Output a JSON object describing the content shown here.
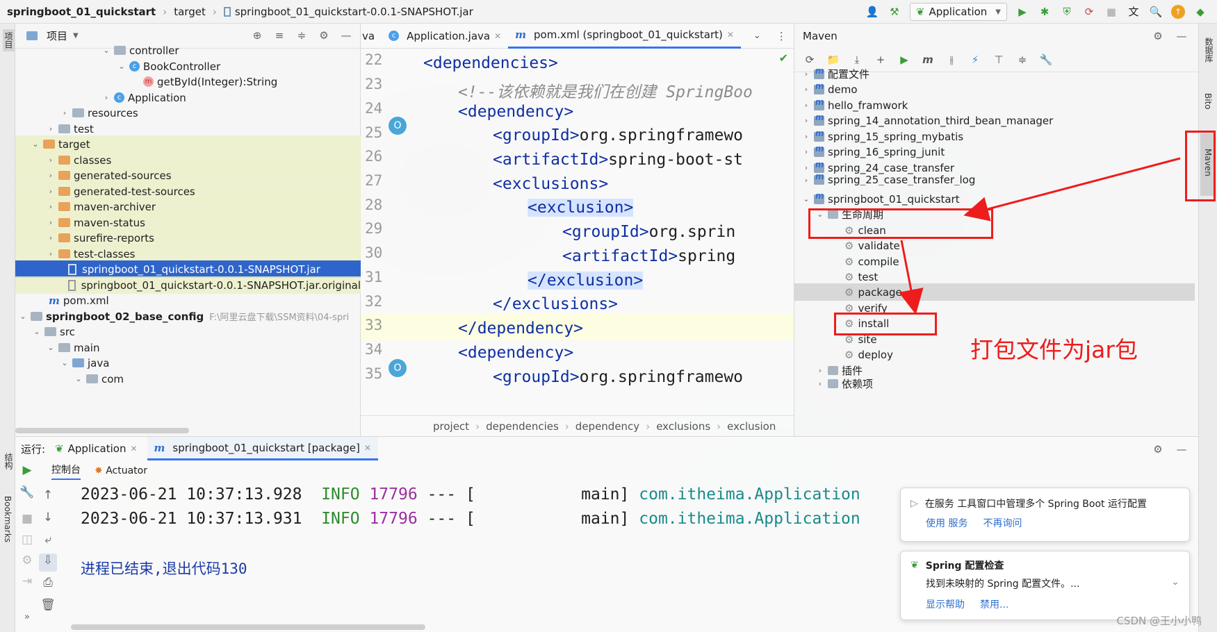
{
  "breadcrumb": {
    "project": "springboot_01_quickstart",
    "folder": "target",
    "file": "springboot_01_quickstart-0.0.1-SNAPSHOT.jar"
  },
  "toolbar": {
    "run_config": "Application"
  },
  "left_strip": {
    "project_tab": "项目",
    "structure_tab": "结构",
    "bookmarks_tab": "Bookmarks"
  },
  "project_panel": {
    "title": "项目",
    "rows": [
      "controller",
      "BookController",
      "getById(Integer):String",
      "Application",
      "resources",
      "test",
      "target",
      "classes",
      "generated-sources",
      "generated-test-sources",
      "maven-archiver",
      "maven-status",
      "surefire-reports",
      "test-classes",
      "springboot_01_quickstart-0.0.1-SNAPSHOT.jar",
      "springboot_01_quickstart-0.0.1-SNAPSHOT.jar.original",
      "pom.xml",
      "springboot_02_base_config",
      "src",
      "main",
      "java",
      "com"
    ],
    "path_hint": "F:\\阿里云盘下载\\SSM资料\\04-spri"
  },
  "editor": {
    "tabs": [
      "va",
      "Application.java",
      "pom.xml (springboot_01_quickstart)"
    ],
    "line_numbers": [
      "22",
      "23",
      "24",
      "25",
      "26",
      "27",
      "28",
      "29",
      "30",
      "31",
      "32",
      "33",
      "34",
      "35"
    ],
    "lines": [
      {
        "open": "<",
        "name": "dependencies",
        "close": ">"
      },
      {
        "comment": "<!--该依赖就是我们在创建 SpringBoo"
      },
      {
        "open": "<",
        "name": "dependency",
        "close": ">"
      },
      {
        "open": "<",
        "name": "groupId",
        "close": ">",
        "text": "org.springframewo"
      },
      {
        "open": "<",
        "name": "artifactId",
        "close": ">",
        "text": "spring-boot-st"
      },
      {
        "open": "<",
        "name": "exclusions",
        "close": ">"
      },
      {
        "open": "<",
        "name": "exclusion",
        "close": ">"
      },
      {
        "open": "<",
        "name": "groupId",
        "close": ">",
        "text": "org.sprin"
      },
      {
        "open": "<",
        "name": "artifactId",
        "close": ">",
        "text": "spring"
      },
      {
        "open": "</",
        "name": "exclusion",
        "close": ">"
      },
      {
        "open": "</",
        "name": "exclusions",
        "close": ">"
      },
      {
        "open": "</",
        "name": "dependency",
        "close": ">"
      },
      {
        "open": "<",
        "name": "dependency",
        "close": ">"
      },
      {
        "open": "<",
        "name": "groupId",
        "close": ">",
        "text": "org.springframewo"
      }
    ],
    "breadcrumb": [
      "project",
      "dependencies",
      "dependency",
      "exclusions",
      "exclusion"
    ]
  },
  "maven": {
    "title": "Maven",
    "projects": [
      "配置文件",
      "demo",
      "hello_framwork",
      "spring_14_annotation_third_bean_manager",
      "spring_15_spring_mybatis",
      "spring_16_spring_junit",
      "spring_24_case_transfer",
      "spring_25_case_transfer_log",
      "springboot_01_quickstart"
    ],
    "lifecycle_label": "生命周期",
    "phases": [
      "clean",
      "validate",
      "compile",
      "test",
      "package",
      "verify",
      "install",
      "site",
      "deploy"
    ],
    "plugins_label": "插件",
    "deps_label": "依赖项"
  },
  "right_strip": {
    "db_tab": "数据库",
    "bito_tab": "Bito",
    "maven_tab": "Maven"
  },
  "run": {
    "label": "运行:",
    "tabs": [
      "Application",
      "springboot_01_quickstart [package]"
    ],
    "subtabs": [
      "控制台",
      "Actuator"
    ],
    "log": [
      {
        "ts": "2023-06-21 10:37:13.928",
        "level": "INFO",
        "pid": "17796",
        "sep": "--- [",
        "thread": "main]",
        "logger": "com.itheima.Application"
      },
      {
        "ts": "2023-06-21 10:37:13.931",
        "level": "INFO",
        "pid": "17796",
        "sep": "--- [",
        "thread": "main]",
        "logger": "com.itheima.Application"
      }
    ],
    "exit_msg": "进程已结束,退出代码130"
  },
  "notifications": [
    {
      "text": "在服务 工具窗口中管理多个 Spring Boot 运行配置",
      "links": [
        "使用 服务",
        "不再询问"
      ]
    },
    {
      "title": "Spring 配置检查",
      "text": "找到未映射的 Spring 配置文件。...",
      "links": [
        "显示帮助",
        "禁用..."
      ]
    }
  ],
  "annotation": {
    "text": "打包文件为jar包",
    "color": "#ee1c1c"
  },
  "watermark": "CSDN @王小小鸭"
}
